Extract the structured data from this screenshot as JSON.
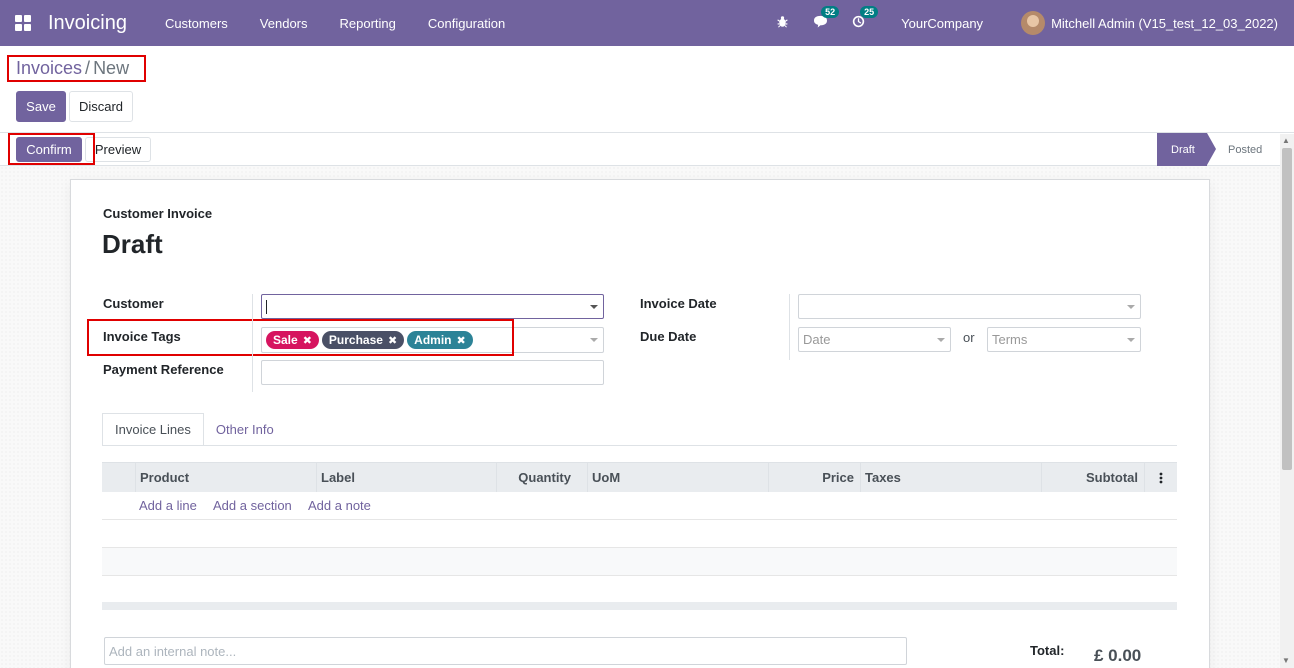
{
  "navbar": {
    "app_name": "Invoicing",
    "menu": [
      "Customers",
      "Vendors",
      "Reporting",
      "Configuration"
    ],
    "messages_count": "52",
    "activities_count": "25",
    "company": "YourCompany",
    "user": "Mitchell Admin (V15_test_12_03_2022)"
  },
  "breadcrumb": {
    "parent": "Invoices",
    "separator": "/",
    "current": "New"
  },
  "buttons": {
    "save": "Save",
    "discard": "Discard",
    "confirm": "Confirm",
    "preview": "Preview"
  },
  "statusbar": {
    "stages": [
      "Draft",
      "Posted"
    ],
    "current": "Draft"
  },
  "form": {
    "type_label": "Customer Invoice",
    "state_title": "Draft",
    "customer_label": "Customer",
    "customer_value": "",
    "tags_label": "Invoice Tags",
    "tags": [
      {
        "name": "Sale",
        "color": "#d6145f"
      },
      {
        "name": "Purchase",
        "color": "#4a5066"
      },
      {
        "name": "Admin",
        "color": "#2c8397"
      }
    ],
    "payment_ref_label": "Payment Reference",
    "invoice_date_label": "Invoice Date",
    "due_date_label": "Due Date",
    "due_date_placeholder": "Date",
    "or_label": "or",
    "terms_placeholder": "Terms"
  },
  "tabs": [
    "Invoice Lines",
    "Other Info"
  ],
  "lines_table": {
    "columns": [
      "Product",
      "Label",
      "Quantity",
      "UoM",
      "Price",
      "Taxes",
      "Subtotal"
    ],
    "links": [
      "Add a line",
      "Add a section",
      "Add a note"
    ]
  },
  "footer": {
    "note_placeholder": "Add an internal note...",
    "total_label": "Total:",
    "total_value": "£ 0.00"
  },
  "colors": {
    "primary": "#71639e",
    "badge": "#017e84"
  }
}
